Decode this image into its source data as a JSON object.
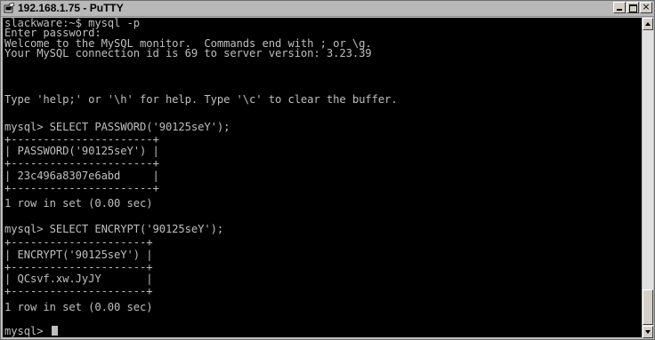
{
  "window": {
    "title": "192.168.1.75 - PuTTY",
    "app_icon": "putty-terminal-icon",
    "controls": {
      "minimize": "minimize-icon",
      "maximize": "maximize-icon",
      "close": "close-icon",
      "close_glyph": "×"
    }
  },
  "colors": {
    "terminal_bg": "#000000",
    "terminal_fg": "#bfbfbf",
    "titlebar_bg": "#b8b8b8"
  },
  "terminal": {
    "line_01": "slackware:~$ mysql -p",
    "line_02": "Enter password:",
    "line_03": "Welcome to the MySQL monitor.  Commands end with ; or \\g.",
    "line_04": "Your MySQL connection id is 69 to server version: 3.23.39",
    "line_05": "",
    "line_06": "Type 'help;' or '\\h' for help. Type '\\c' to clear the buffer.",
    "line_07": "",
    "line_08": "mysql> SELECT PASSWORD('90125seY');",
    "line_09": "+----------------------+",
    "line_10": "| PASSWORD('90125seY') |",
    "line_11": "+----------------------+",
    "line_12": "| 23c496a8307e6abd     |",
    "line_13": "+----------------------+",
    "line_14": "1 row in set (0.00 sec)",
    "line_15": "",
    "line_16": "mysql> SELECT ENCRYPT('90125seY');",
    "line_17": "+---------------------+",
    "line_18": "| ENCRYPT('90125seY') |",
    "line_19": "+---------------------+",
    "line_20": "| QCsvf.xw.JyJY       |",
    "line_21": "+---------------------+",
    "line_22": "1 row in set (0.00 sec)",
    "line_23": "",
    "prompt": "mysql> "
  },
  "scrollbar": {
    "up_icon": "scroll-up-arrow-icon",
    "down_icon": "scroll-down-arrow-icon",
    "position_fraction": 0.95
  }
}
